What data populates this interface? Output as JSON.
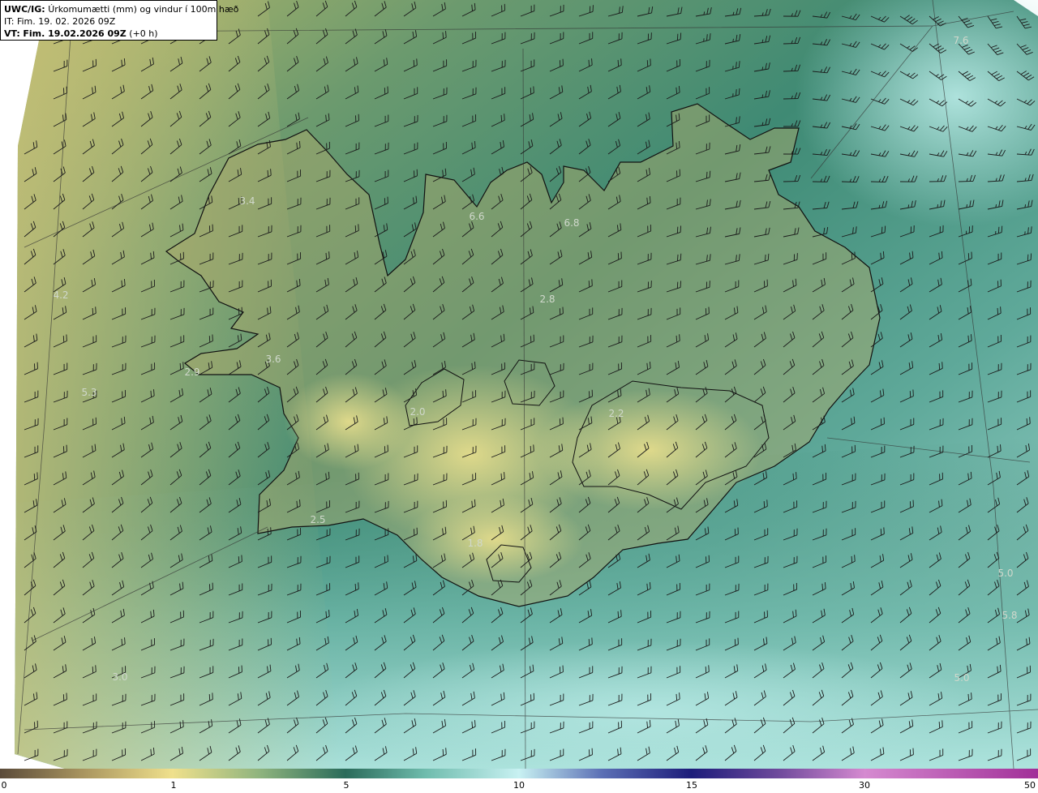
{
  "header": {
    "source": "UWC/IG:",
    "title": "Úrkomumætti (mm) og vindur í 100m hæð",
    "it_label": "IT:",
    "it_value": "Fim. 19. 02. 2026 09Z",
    "vt_label": "VT:",
    "vt_value": "Fim. 19.02.2026 09Z",
    "vt_offset": "(+0 h)"
  },
  "map": {
    "type": "precipitable water + wind barbs",
    "region": "Iceland",
    "value_labels": [
      "7.6",
      "3.4",
      "6.6",
      "6.8",
      "2.8",
      "4.2",
      "3.6",
      "2.9",
      "5.3",
      "2.0",
      "2.2",
      "2.5",
      "1.8",
      "5.0",
      "5.8",
      "3.0",
      "5.0"
    ]
  },
  "colorbar": {
    "ticks": [
      "0",
      "1",
      "5",
      "10",
      "15",
      "30",
      "50"
    ],
    "colors": [
      "#5b4b3a",
      "#a9955f",
      "#efe08c",
      "#4f8f7a",
      "#2a6b5a",
      "#9fdfd8",
      "#c8f1f2",
      "#5b6fb5",
      "#1c1c7a",
      "#6f4a9c",
      "#d58ad0",
      "#a12f98"
    ]
  }
}
